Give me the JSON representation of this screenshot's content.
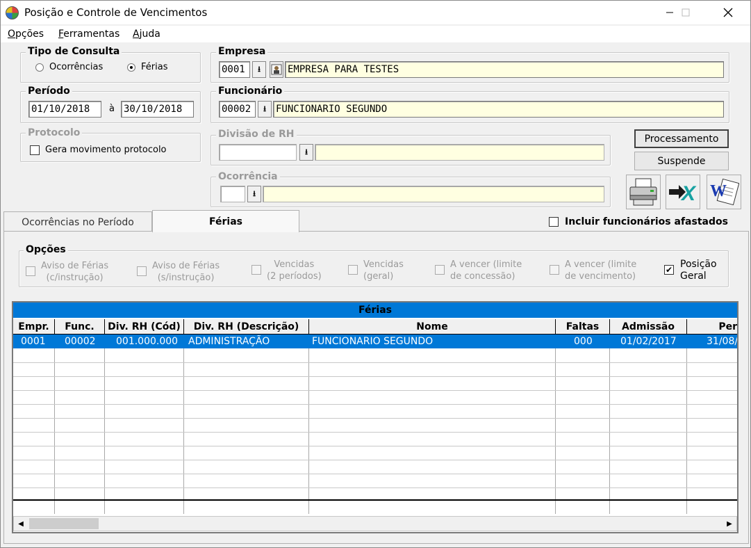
{
  "window": {
    "title": "Posição e Controle de Vencimentos"
  },
  "menu": [
    {
      "label_u": "O",
      "label_rest": "pções"
    },
    {
      "label_u": "F",
      "label_rest": "erramentas"
    },
    {
      "label_u": "A",
      "label_rest": "juda"
    }
  ],
  "tipo_consulta": {
    "title": "Tipo de Consulta",
    "opt1": "Ocorrências",
    "opt2": "Férias",
    "selected": "Férias"
  },
  "periodo": {
    "title": "Período",
    "start": "01/10/2018",
    "sep": "à",
    "end": "30/10/2018"
  },
  "protocolo": {
    "title": "Protocolo",
    "check_label": "Gera movimento protocolo"
  },
  "empresa": {
    "title": "Empresa",
    "code": "0001",
    "name": "EMPRESA PARA TESTES"
  },
  "funcionario": {
    "title": "Funcionário",
    "code": "00002",
    "name": "FUNCIONARIO SEGUNDO"
  },
  "divisao": {
    "title": "Divisão de RH",
    "code": "",
    "name": ""
  },
  "ocorrencia": {
    "title": "Ocorrência",
    "code": "",
    "name": ""
  },
  "buttons": {
    "processamento": "Processamento",
    "suspende": "Suspende"
  },
  "tabs": {
    "tab1": "Ocorrências no Período",
    "tab2": "Férias"
  },
  "incluir": {
    "label": "Incluir funcionários afastados",
    "checked": false
  },
  "opcoes": {
    "title": "Opções",
    "items": [
      {
        "l1": "Aviso de Férias",
        "l2": "(c/instrução)"
      },
      {
        "l1": "Aviso de Férias",
        "l2": "(s/instrução)"
      },
      {
        "l1": "Vencidas",
        "l2": "(2 períodos)"
      },
      {
        "l1": "Vencidas",
        "l2": "(geral)"
      },
      {
        "l1": "A vencer (limite",
        "l2": "de concessão)"
      },
      {
        "l1": "A vencer (limite",
        "l2": "de vencimento)"
      },
      {
        "l1": "Posição",
        "l2": "Geral"
      }
    ]
  },
  "grid": {
    "title": "Férias",
    "columns": [
      "Empr.",
      "Func.",
      "Div. RH (Cód)",
      "Div. RH (Descrição)",
      "Nome",
      "Faltas",
      "Admissão",
      "Per"
    ],
    "row": [
      "0001",
      "00002",
      "001.000.000",
      "ADMINISTRAÇÃO",
      "FUNCIONARIO SEGUNDO",
      "000",
      "01/02/2017",
      "31/08/"
    ]
  }
}
